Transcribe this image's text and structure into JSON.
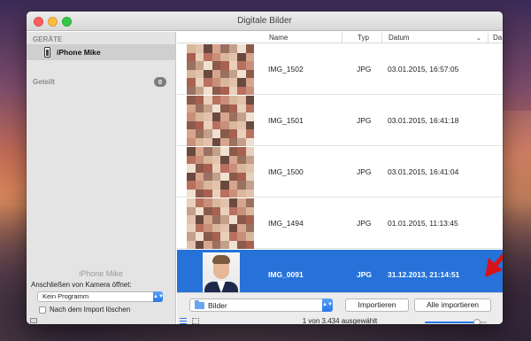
{
  "window": {
    "title": "Digitale Bilder"
  },
  "sidebar": {
    "section_devices": "GERÄTE",
    "device_label": "iPhone Mike",
    "section_shared": "Geteilt",
    "shared_count": "0",
    "bottom": {
      "device_name": "iPhone Mike",
      "connect_label": "Anschließen von Kamera öffnet:",
      "connect_select_value": "Kein Programm",
      "delete_after_import_label": "Nach dem Import löschen",
      "delete_after_import_checked": false
    }
  },
  "list": {
    "columns": {
      "name": "Name",
      "typ": "Typ",
      "datum": "Datum",
      "extra": "Da"
    },
    "rows": [
      {
        "name": "IMG_1502",
        "typ": "JPG",
        "date": "03.01.2015, 16:57:05",
        "selected": false
      },
      {
        "name": "IMG_1501",
        "typ": "JPG",
        "date": "03.01.2015, 16:41:18",
        "selected": false
      },
      {
        "name": "IMG_1500",
        "typ": "JPG",
        "date": "03.01.2015, 16:41:04",
        "selected": false
      },
      {
        "name": "IMG_1494",
        "typ": "JPG",
        "date": "01.01.2015, 11:13:45",
        "selected": false
      },
      {
        "name": "IMG_0091",
        "typ": "JPG",
        "date": "31.12.2013, 21:14:51",
        "selected": true
      }
    ]
  },
  "bottombar": {
    "folder_select_value": "Bilder",
    "import_button": "Importieren",
    "import_all_button": "Alle importieren",
    "status_text": "1 von 3.434 ausgewählt",
    "thumbnail_size_fraction": 0.84
  },
  "colors": {
    "selection": "#2672d8",
    "accent": "#2a76e8",
    "annotation_arrow": "#d8121a"
  }
}
